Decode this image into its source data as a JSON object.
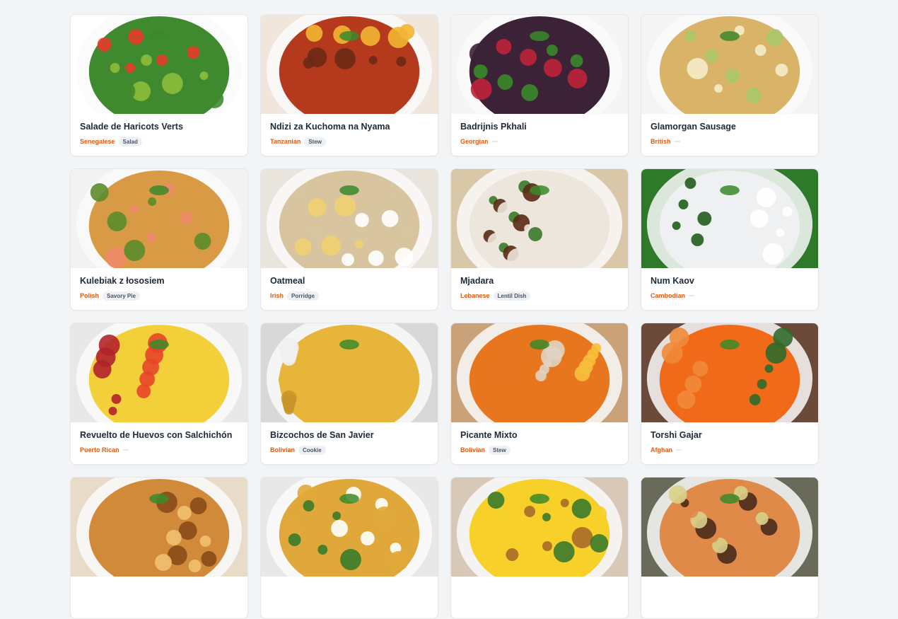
{
  "recipes": [
    {
      "title": "Salade de Haricots Verts",
      "cuisine": "Senegalese",
      "category": "Salad",
      "image": "green-bean-salad-photo",
      "colors": [
        "#ffffff",
        "#3f8a2e",
        "#e63b2a",
        "#8dbb3a"
      ]
    },
    {
      "title": "Ndizi za Kuchoma na Nyama",
      "cuisine": "Tanzanian",
      "category": "Stew",
      "image": "meat-stew-bowl-photo",
      "colors": [
        "#f0e6dc",
        "#b5391d",
        "#6b2a16",
        "#f2b632"
      ]
    },
    {
      "title": "Badrijnis Pkhali",
      "cuisine": "Georgian",
      "category": "",
      "image": "eggplant-rolls-photo",
      "colors": [
        "#f5f5f5",
        "#3b2236",
        "#c0223a",
        "#3a8a2a"
      ]
    },
    {
      "title": "Glamorgan Sausage",
      "cuisine": "British",
      "category": "",
      "image": "sausage-plate-photo",
      "colors": [
        "#f4f4f4",
        "#d9b468",
        "#a9c76a",
        "#f4ecc8"
      ]
    },
    {
      "title": "Kulebiak z łososiem",
      "cuisine": "Polish",
      "category": "Savory Pie",
      "image": "salmon-pie-photo",
      "colors": [
        "#f2f2f2",
        "#d99a45",
        "#f08a6a",
        "#5b8c2a"
      ]
    },
    {
      "title": "Oatmeal",
      "cuisine": "Irish",
      "category": "Porridge",
      "image": "oatmeal-bowl-photo",
      "colors": [
        "#e9e4dc",
        "#d8c5a0",
        "#f0d070",
        "#ffffff"
      ]
    },
    {
      "title": "Mjadara",
      "cuisine": "Lebanese",
      "category": "Lentil Dish",
      "image": "lentil-rice-photo",
      "colors": [
        "#d9c8a8",
        "#ece6dc",
        "#5a2a14",
        "#3a7a2a"
      ]
    },
    {
      "title": "Num Kaov",
      "cuisine": "Cambodian",
      "category": "",
      "image": "rice-cake-leaf-photo",
      "colors": [
        "#2f7a2a",
        "#eef0f2",
        "#1f5e1a",
        "#ffffff"
      ]
    },
    {
      "title": "Revuelto de Huevos con Salchichón",
      "cuisine": "Puerto Rican",
      "category": "",
      "image": "scrambled-eggs-sausage-photo",
      "colors": [
        "#e8e8e8",
        "#f3d03a",
        "#b3222a",
        "#e8452a"
      ]
    },
    {
      "title": "Bizcochos de San Javier",
      "cuisine": "Bolivian",
      "category": "Cookie",
      "image": "yellow-biscuits-photo",
      "colors": [
        "#d8d8d8",
        "#e6b53a",
        "#f0f0f0",
        "#c9952a"
      ]
    },
    {
      "title": "Picante Mixto",
      "cuisine": "Bolivian",
      "category": "Stew",
      "image": "chicken-stew-rice-photo",
      "colors": [
        "#c9a27a",
        "#e8761f",
        "#f7c03a",
        "#e0d4c2"
      ]
    },
    {
      "title": "Torshi Gajar",
      "cuisine": "Afghan",
      "category": "",
      "image": "pickled-carrots-photo",
      "colors": [
        "#6b4a3a",
        "#f06a1a",
        "#2f6a2a",
        "#f08a3a"
      ]
    },
    {
      "title": "",
      "cuisine": "",
      "category": "",
      "image": "meat-pie-photo",
      "colors": [
        "#e8dcc8",
        "#d08a3a",
        "#8a4a1a",
        "#f0c070"
      ]
    },
    {
      "title": "",
      "cuisine": "",
      "category": "",
      "image": "soup-bowl-photo",
      "colors": [
        "#e8e8e8",
        "#e0a83a",
        "#ffffff",
        "#3a7a2a"
      ]
    },
    {
      "title": "",
      "cuisine": "",
      "category": "",
      "image": "eggs-on-toast-photo",
      "colors": [
        "#d8c8b8",
        "#f7d02a",
        "#a86a2a",
        "#3a7a2a"
      ]
    },
    {
      "title": "",
      "cuisine": "",
      "category": "",
      "image": "fish-rye-bread-photo",
      "colors": [
        "#6a6a5a",
        "#e08a4a",
        "#4a2a1a",
        "#d8d08a"
      ]
    }
  ]
}
